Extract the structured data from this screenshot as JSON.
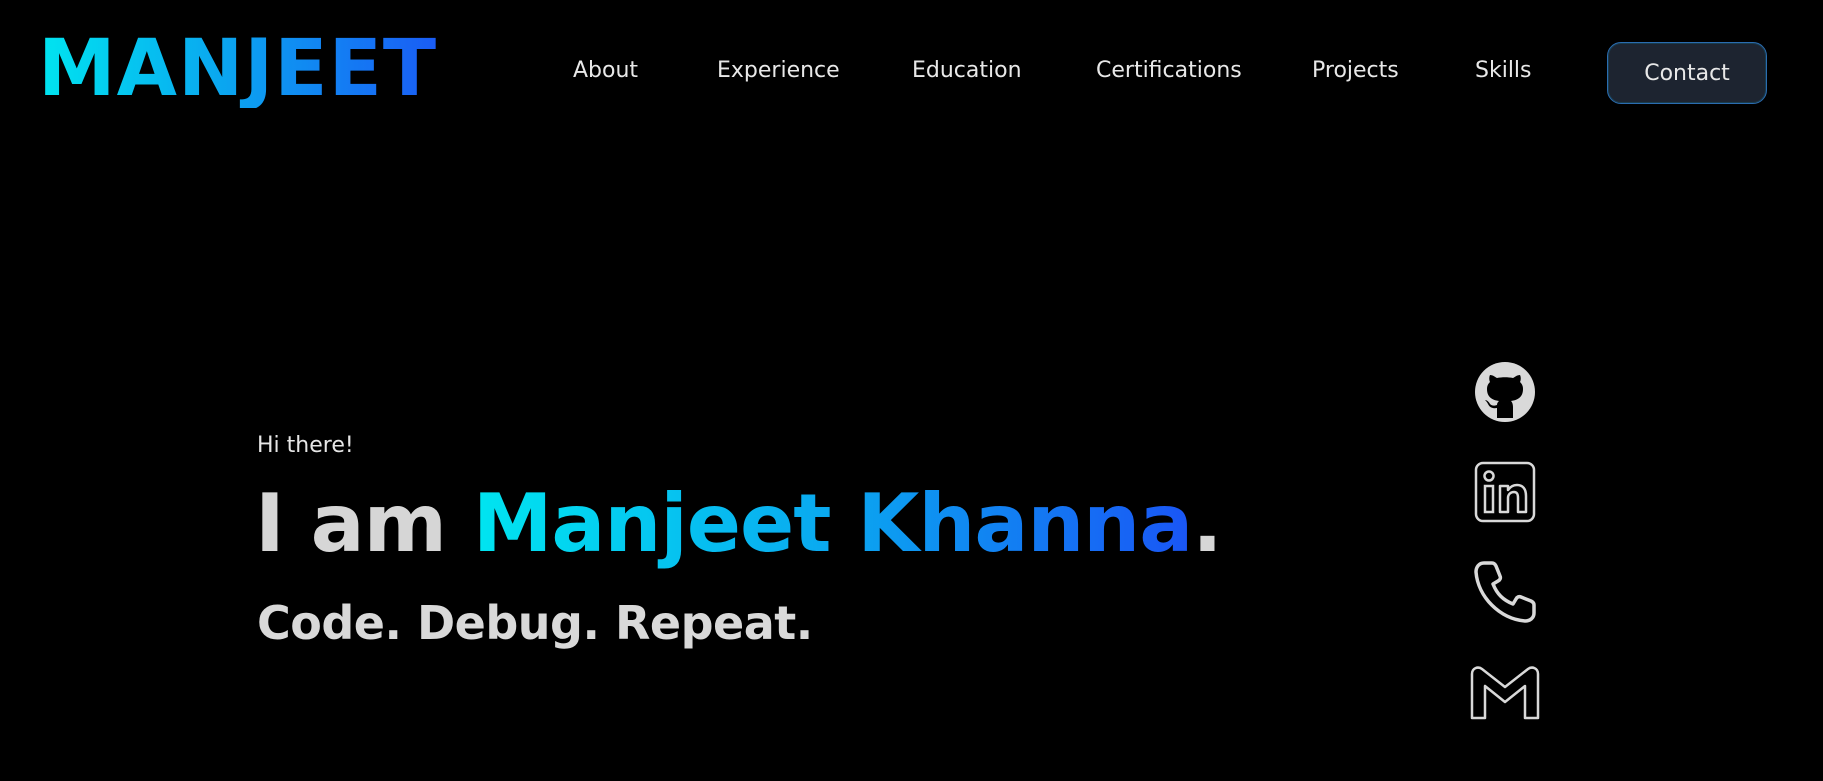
{
  "header": {
    "logo": "MANJEET",
    "nav": [
      "About",
      "Experience",
      "Education",
      "Certifications",
      "Projects",
      "Skills"
    ],
    "contact_label": "Contact"
  },
  "hero": {
    "greeting": "Hi there!",
    "intro": "I am ",
    "name": "Manjeet Khanna",
    "period": ".",
    "tagline": "Code. Debug. Repeat."
  },
  "social": {
    "icons": [
      "github-icon",
      "linkedin-icon",
      "phone-icon",
      "gmail-icon"
    ]
  },
  "colors": {
    "background": "#000000",
    "text": "#d9d9d9",
    "gradient_start": "#00e5f0",
    "gradient_end": "#1a55f5",
    "contact_bg": "#1d2430",
    "contact_border": "#2b6cb0"
  }
}
